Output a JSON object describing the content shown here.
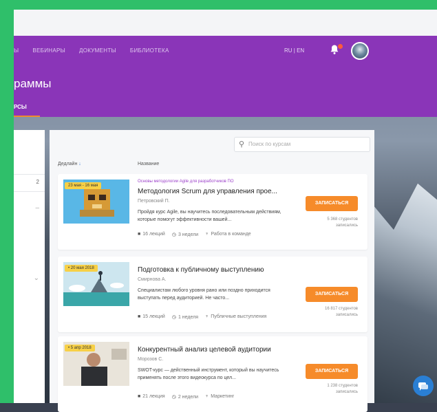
{
  "nav": {
    "items": [
      "Ы",
      "ВЕБИНАРЫ",
      "ДОКУМЕНТЫ",
      "БИБЛИОТЕКА"
    ],
    "lang": "RU | EN"
  },
  "header": {
    "title": "раммы",
    "tab": "РСЫ"
  },
  "leftpanel": {
    "number": "2"
  },
  "search": {
    "placeholder": "Поиск по курсам"
  },
  "columns": {
    "sort": "Дедлайн",
    "name": "Название"
  },
  "courses": [
    {
      "badge": "23 мая - 16 мая",
      "tag": "Основы методологии Agile для разработчиков ПО",
      "title": "Методология Scrum для управления прое...",
      "author": "Петровский П.",
      "desc": "Пройдя курс Agile, вы научитесь последовательным действиям, которые помогут эффективности вашей...",
      "lessons": "16 лекций",
      "weeks": "3 недели",
      "topic": "Работа в команде",
      "button": "ЗАПИСАТЬСЯ",
      "count": "5 368 студентов записались"
    },
    {
      "badge": "• 20 мая 2018",
      "tag": "",
      "title": "Подготовка к публичному выступлению",
      "author": "Смирнова А.",
      "desc": "Специалистам любого уровня рано или поздно приходится выступать перед аудиторией. Не часто...",
      "lessons": "15 лекций",
      "weeks": "1 неделя",
      "topic": "Публичные выступления",
      "button": "ЗАПИСАТЬСЯ",
      "count": "16 817 студентов записались"
    },
    {
      "badge": "• 5 апр 2018",
      "tag": "",
      "title": "Конкурентный анализ целевой аудитории",
      "author": "Морозов С.",
      "desc": "SWOT-курс — действенный инструмент, который вы научитесь применять после этого видеокурса по цел...",
      "lessons": "21 лекция",
      "weeks": "2 недели",
      "topic": "Маркетинг",
      "button": "ЗАПИСАТЬСЯ",
      "count": "1 238 студентов записались"
    }
  ],
  "colors": {
    "purple": "#8a35b8",
    "orange": "#f68b2a",
    "green": "#2fbf6a"
  }
}
